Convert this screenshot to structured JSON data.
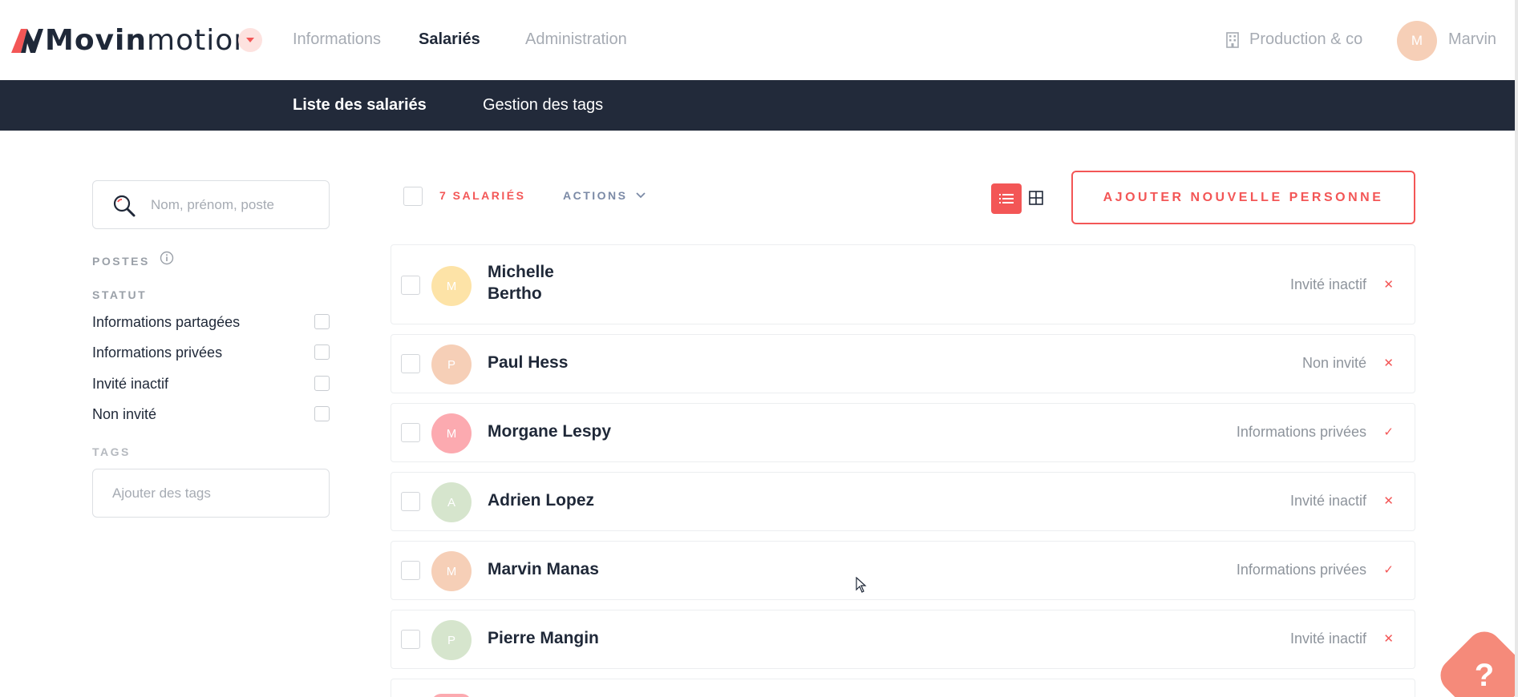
{
  "app": {
    "brand_bold": "Movin",
    "brand_light": "motion",
    "colors": {
      "accent": "#f35656",
      "navy": "#222a3a",
      "muted": "#a6abb3"
    }
  },
  "topnav": {
    "items": [
      {
        "label": "Informations",
        "active": false
      },
      {
        "label": "Salariés",
        "active": true
      },
      {
        "label": "Administration",
        "active": false
      }
    ],
    "company": "Production & co",
    "user_initial": "M",
    "user_name": "Marvin"
  },
  "subnav": {
    "items": [
      {
        "label": "Liste des salariés",
        "active": true
      },
      {
        "label": "Gestion des tags",
        "active": false
      }
    ]
  },
  "sidebar": {
    "search_placeholder": "Nom, prénom, poste",
    "postes_label": "POSTES",
    "statut_label": "STATUT",
    "filters": [
      {
        "label": "Informations partagées",
        "checked": false
      },
      {
        "label": "Informations privées",
        "checked": false
      },
      {
        "label": "Invité inactif",
        "checked": false
      },
      {
        "label": "Non invité",
        "checked": false
      }
    ],
    "tags_label": "TAGS",
    "tags_placeholder": "Ajouter des tags"
  },
  "list_header": {
    "count_label": "7 SALARIÉS",
    "actions_label": "ACTIONS",
    "add_button": "AJOUTER NOUVELLE PERSONNE",
    "view": "list"
  },
  "employees": [
    {
      "initial": "M",
      "first": "Michelle",
      "last": "Bertho",
      "status": "Invité inactif",
      "mark": "✕",
      "avatar_color": "#fde3a7"
    },
    {
      "initial": "P",
      "first": "Paul",
      "last": "Hess",
      "status": "Non invité",
      "mark": "✕",
      "avatar_color": "#f6cfb7"
    },
    {
      "initial": "M",
      "first": "Morgane",
      "last": "Lespy",
      "status": "Informations privées",
      "mark": "✓",
      "avatar_color": "#fcaab0"
    },
    {
      "initial": "A",
      "first": "Adrien",
      "last": "Lopez",
      "status": "Invité inactif",
      "mark": "✕",
      "avatar_color": "#d6e5cd"
    },
    {
      "initial": "M",
      "first": "Marvin",
      "last": "Manas",
      "status": "Informations privées",
      "mark": "✓",
      "avatar_color": "#f6cfb7"
    },
    {
      "initial": "P",
      "first": "Pierre",
      "last": "Mangin",
      "status": "Invité inactif",
      "mark": "✕",
      "avatar_color": "#d6e5cd"
    }
  ],
  "help_label": "?"
}
